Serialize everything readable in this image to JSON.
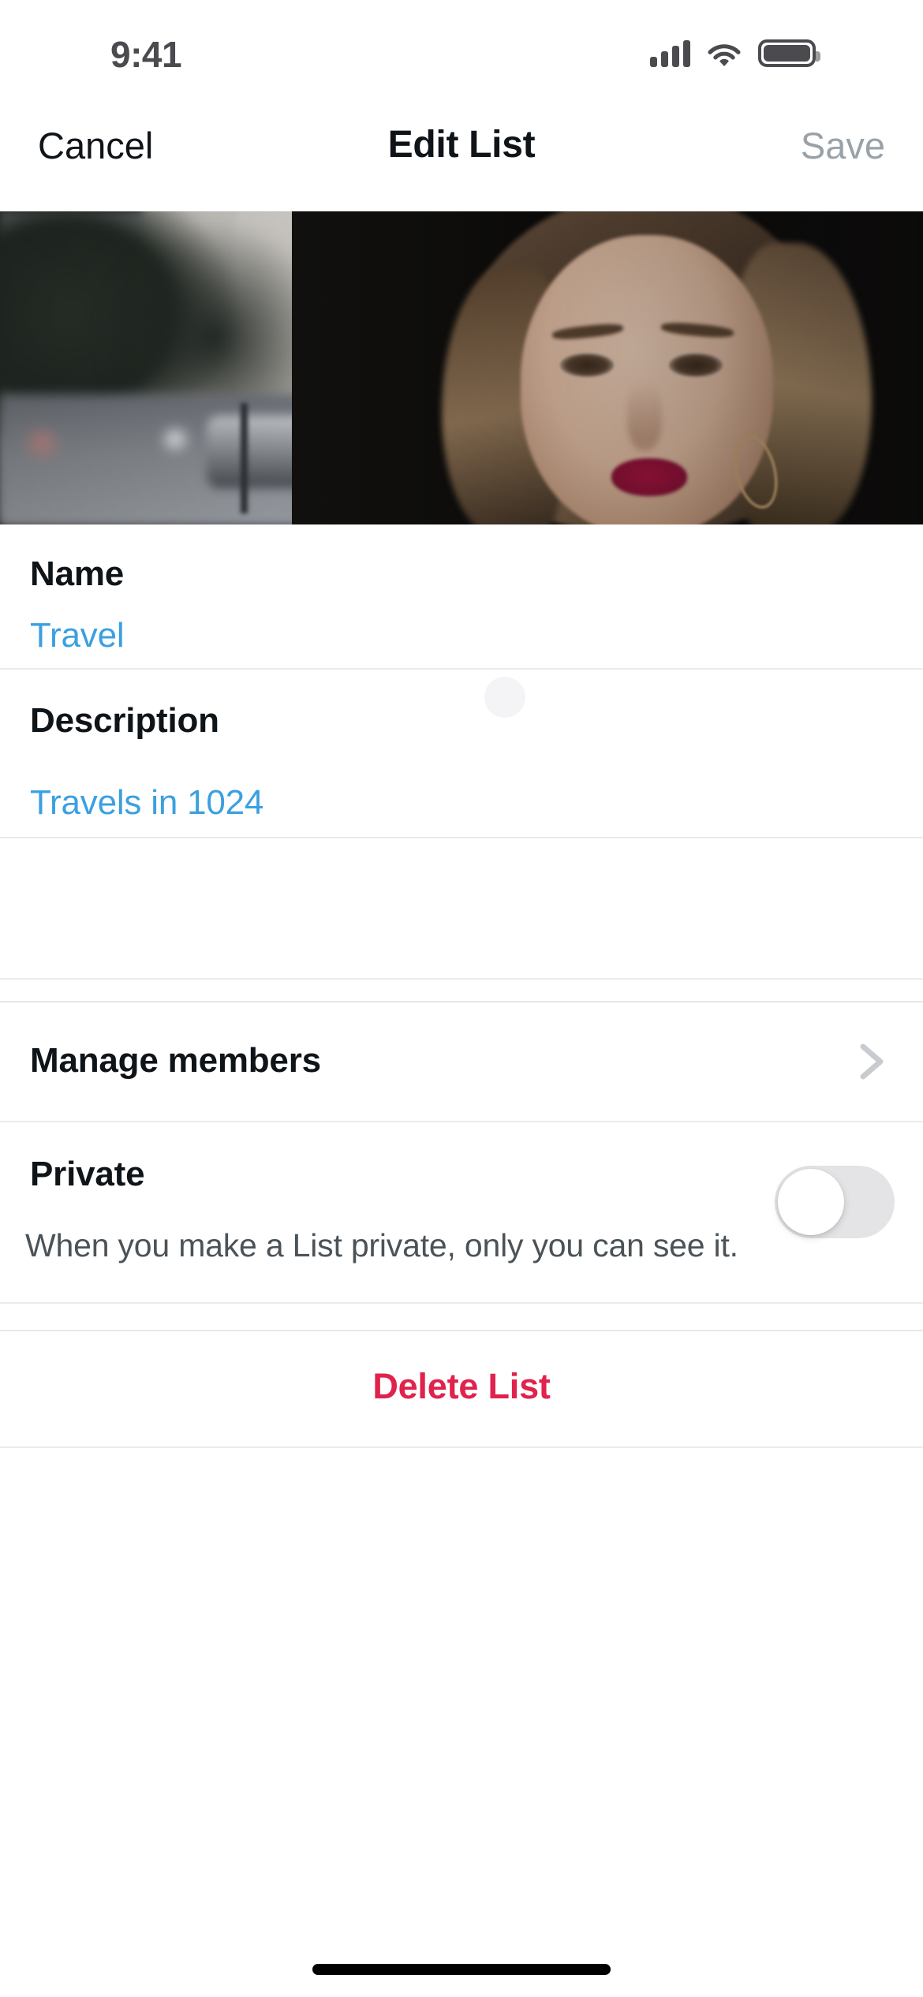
{
  "status_bar": {
    "time": "9:41",
    "cellular_icon": "signal-bars-icon",
    "wifi_icon": "wifi-icon",
    "battery_icon": "battery-full-icon"
  },
  "nav_bar": {
    "cancel_label": "Cancel",
    "title": "Edit List",
    "save_label": "Save",
    "save_disabled": true
  },
  "banner": {
    "camera_icon": "camera-sparkle-icon",
    "alt": "List banner photo"
  },
  "fields": [
    {
      "label": "Name",
      "value": "Travel"
    },
    {
      "label": "Description",
      "value": "Travels in 1024"
    }
  ],
  "rows": {
    "manage_members": {
      "label": "Manage members",
      "chevron_icon": "chevron-right-icon"
    },
    "private": {
      "label": "Private",
      "description": "When you make a List private, only you can see it.",
      "toggle_state": "off"
    },
    "delete": {
      "label": "Delete List"
    }
  },
  "colors": {
    "accent_blue": "#3ba0e0",
    "danger_red": "#e0224c",
    "text_primary": "#0f1419",
    "text_secondary": "#4b5358",
    "text_disabled": "#9aa2a8",
    "separator": "#ebebec",
    "toggle_track_off": "#e4e4e6"
  }
}
